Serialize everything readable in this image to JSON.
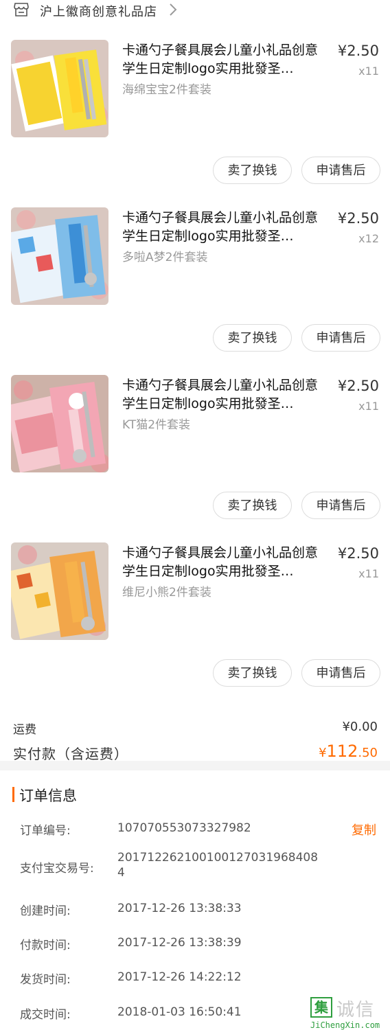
{
  "shop": {
    "name": "沪上徽商创意礼品店",
    "icon": "shop-icon",
    "chevron": "chevron-right-icon"
  },
  "items": [
    {
      "title": "卡通勺子餐具展会儿童小礼品创意学生日定制logo实用批發圣…",
      "variant": "海绵宝宝2件套装",
      "price": "¥2.50",
      "qty": "x11",
      "btn_sell": "卖了换钱",
      "btn_after": "申请售后"
    },
    {
      "title": "卡通勺子餐具展会儿童小礼品创意学生日定制logo实用批發圣…",
      "variant": "多啦A梦2件套装",
      "price": "¥2.50",
      "qty": "x12",
      "btn_sell": "卖了换钱",
      "btn_after": "申请售后"
    },
    {
      "title": "卡通勺子餐具展会儿童小礼品创意学生日定制logo实用批發圣…",
      "variant": "KT猫2件套装",
      "price": "¥2.50",
      "qty": "x11",
      "btn_sell": "卖了换钱",
      "btn_after": "申请售后"
    },
    {
      "title": "卡通勺子餐具展会儿童小礼品创意学生日定制logo实用批發圣…",
      "variant": "维尼小熊2件套装",
      "price": "¥2.50",
      "qty": "x11",
      "btn_sell": "卖了换钱",
      "btn_after": "申请售后"
    }
  ],
  "summary": {
    "shipping_label": "运费",
    "shipping_value": "¥0.00",
    "total_label": "实付款（含运费）",
    "total_symbol": "¥",
    "total_int": "112",
    "total_dec": ".50"
  },
  "order_info": {
    "title": "订单信息",
    "copy_label": "复制",
    "rows": [
      {
        "label": "订单编号:",
        "value": "107070553073327982"
      },
      {
        "label": "支付宝交易号:",
        "value": "2017122621001001270319684084"
      },
      {
        "label": "创建时间:",
        "value": "2017-12-26 13:38:33"
      },
      {
        "label": "付款时间:",
        "value": "2017-12-26 13:38:39"
      },
      {
        "label": "发货时间:",
        "value": "2017-12-26 14:22:12"
      },
      {
        "label": "成交时间:",
        "value": "2018-01-03 16:50:41"
      }
    ]
  },
  "watermark": {
    "box_char": "集",
    "text": "诚信",
    "url": "JiChengXin.com"
  },
  "colors": {
    "accent": "#ff6a00",
    "muted": "#999999",
    "divider": "#f4f4f4"
  }
}
